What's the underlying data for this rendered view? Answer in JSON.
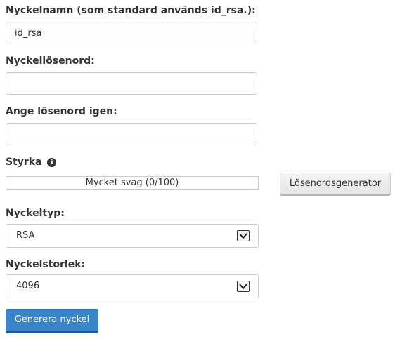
{
  "form": {
    "key_name": {
      "label": "Nyckelnamn (som standard används id_rsa.):",
      "value": "id_rsa"
    },
    "key_password": {
      "label": "Nyckellösenord:",
      "value": ""
    },
    "confirm_password": {
      "label": "Ange lösenord igen:",
      "value": ""
    },
    "strength": {
      "label": "Styrka",
      "info_icon": "info-icon",
      "text": "Mycket svag (0/100)",
      "score": 0,
      "color": "#d9534f"
    },
    "password_generator_label": "Lösenordsgenerator",
    "key_type": {
      "label": "Nyckeltyp:",
      "selected": "RSA"
    },
    "key_size": {
      "label": "Nyckelstorlek:",
      "selected": "4096"
    },
    "generate_label": "Generera nyckel"
  },
  "colors": {
    "primary": "#3a85c7",
    "text": "#333333",
    "border": "#cccccc"
  }
}
